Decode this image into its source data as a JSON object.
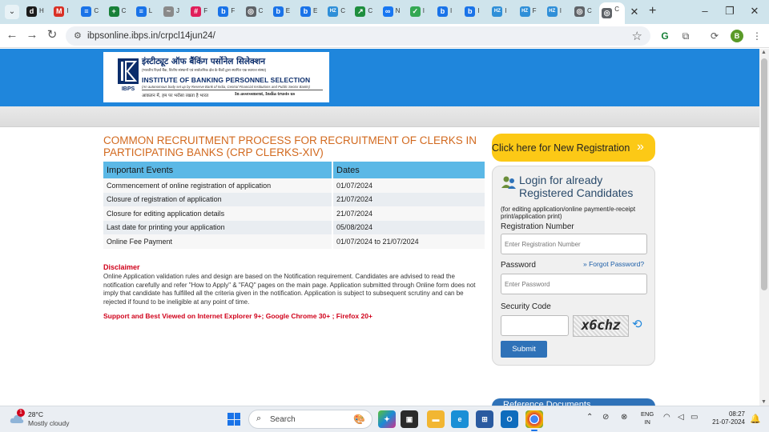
{
  "browser": {
    "tabs": [
      {
        "icon": "d-icon",
        "glyph": "d",
        "color": "#1b1b1b",
        "label": "H"
      },
      {
        "icon": "gmail-icon",
        "glyph": "M",
        "color": "#d93025",
        "label": "I"
      },
      {
        "icon": "docs-icon",
        "glyph": "≡",
        "color": "#1a73e8",
        "label": "C"
      },
      {
        "icon": "add-icon",
        "glyph": "+",
        "color": "#188038",
        "label": "C"
      },
      {
        "icon": "docs-icon",
        "glyph": "≡",
        "color": "#1a73e8",
        "label": "L"
      },
      {
        "icon": "site-icon",
        "glyph": "~",
        "color": "#8a8a8a",
        "label": "J"
      },
      {
        "icon": "slack-icon",
        "glyph": "#",
        "color": "#e01e5a",
        "label": "F"
      },
      {
        "icon": "bing-icon",
        "glyph": "b",
        "color": "#1a73e8",
        "label": "F"
      },
      {
        "icon": "globe-icon",
        "glyph": "◎",
        "color": "#5f6368",
        "label": "C"
      },
      {
        "icon": "bing-icon",
        "glyph": "b",
        "color": "#1a73e8",
        "label": "E"
      },
      {
        "icon": "bing-icon",
        "glyph": "b",
        "color": "#1a73e8",
        "label": "E"
      },
      {
        "icon": "hz-icon",
        "glyph": "HZ",
        "color": "#2f8fd8",
        "label": "C"
      },
      {
        "icon": "chart-icon",
        "glyph": "↗",
        "color": "#1e8e3e",
        "label": "C"
      },
      {
        "icon": "meta-icon",
        "glyph": "∞",
        "color": "#1877f2",
        "label": "N"
      },
      {
        "icon": "check-icon",
        "glyph": "✓",
        "color": "#34a853",
        "label": "I"
      },
      {
        "icon": "bing-icon",
        "glyph": "b",
        "color": "#1a73e8",
        "label": "I"
      },
      {
        "icon": "bing-icon",
        "glyph": "b",
        "color": "#1a73e8",
        "label": "I"
      },
      {
        "icon": "hz-icon",
        "glyph": "HZ",
        "color": "#2f8fd8",
        "label": "I"
      },
      {
        "icon": "hz-icon",
        "glyph": "HZ",
        "color": "#2f8fd8",
        "label": "F"
      },
      {
        "icon": "hz-icon",
        "glyph": "HZ",
        "color": "#2f8fd8",
        "label": "I"
      },
      {
        "icon": "globe-icon",
        "glyph": "◎",
        "color": "#5f6368",
        "label": "C"
      },
      {
        "icon": "globe-icon",
        "glyph": "◎",
        "color": "#5f6368",
        "label": "C"
      }
    ],
    "url": "ibpsonline.ibps.in/crpcl14jun24/",
    "profile_initial": "B"
  },
  "header": {
    "org_hindi": "इंस्टीट्यूट ऑफ बैंकिंग पर्सोनेल सिलेक्शन",
    "org_hindi_sub": "(भारतीय रिज़र्व बैंक, वित्तीय संस्थानों एवं सार्वजनिक क्षेत्र के बैंकों द्वारा स्थापित एक स्वायत्त संस्था)",
    "org_english": "INSTITUTE OF BANKING PERSONNEL SELECTION",
    "org_english_sub": "(An autonomous body set up by Reserve Bank of India, Central Financial Institutions and Public Sector Banks)",
    "tagline_hindi": "आकलन में, हम पर भरोसा रखता है भारत",
    "tagline_english": "In assessment, India trusts us",
    "logo_text": "IBPS"
  },
  "main": {
    "title": "COMMON RECRUITMENT PROCESS FOR RECRUITMENT OF CLERKS IN PARTICIPATING BANKS (CRP CLERKS-XIV)",
    "table_headers": [
      "Important Events",
      "Dates"
    ],
    "table_rows": [
      [
        "Commencement of online registration of application",
        "01/07/2024"
      ],
      [
        "Closure of registration of application",
        "21/07/2024"
      ],
      [
        "Closure for editing application details",
        "21/07/2024"
      ],
      [
        "Last date for printing your application",
        "05/08/2024"
      ],
      [
        "Online Fee Payment",
        "01/07/2024 to 21/07/2024"
      ]
    ],
    "disclaimer_heading": "Disclaimer",
    "disclaimer_text": "Online Application validation rules and design are based on the Notification requirement. Candidates are advised to read the notification carefully and refer \"How to Apply\" & \"FAQ\" pages on the main page. Application submitted through Online form does not imply that candidate has fulfilled all the criteria given in the notification. Application is subject to subsequent scrutiny and can be rejected if found to be ineligible at any point of time.",
    "support_text": "Support and Best Viewed on Internet Explorer 9+; Google Chrome 30+ ; Firefox 20+"
  },
  "sidebar": {
    "new_registration": "Click here for New Registration",
    "login_title_line1": "Login for already",
    "login_title_line2": "Registered Candidates",
    "login_note": "(for editing application/online payment/e-receipt print/application print)",
    "registration_label": "Registration Number",
    "registration_placeholder": "Enter Registration Number",
    "password_label": "Password",
    "forgot_password": "Forgot Password?",
    "password_placeholder": "Enter Password",
    "security_label": "Security Code",
    "captcha_text": "x6chz",
    "submit_label": "Submit",
    "reference_docs": "Reference Documents"
  },
  "taskbar": {
    "weather_temp": "28°C",
    "weather_desc": "Mostly cloudy",
    "weather_badge": "1",
    "search_placeholder": "Search",
    "lang_line1": "ENG",
    "lang_line2": "IN",
    "time": "08:27",
    "date": "21-07-2024"
  }
}
